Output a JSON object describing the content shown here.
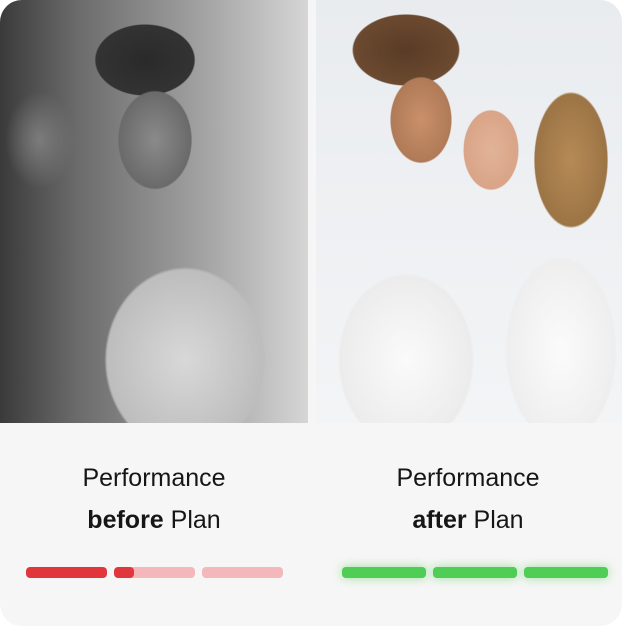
{
  "before": {
    "title": "Performance",
    "emphasis": "before",
    "suffix": " Plan",
    "progress_segments": [
      1.0,
      0.25,
      0.0
    ],
    "color": "#e2363d",
    "track_color": "#f4b8ba"
  },
  "after": {
    "title": "Performance",
    "emphasis": "after",
    "suffix": " Plan",
    "progress_segments": [
      1.0,
      1.0,
      1.0
    ],
    "color": "#4fcd54"
  }
}
